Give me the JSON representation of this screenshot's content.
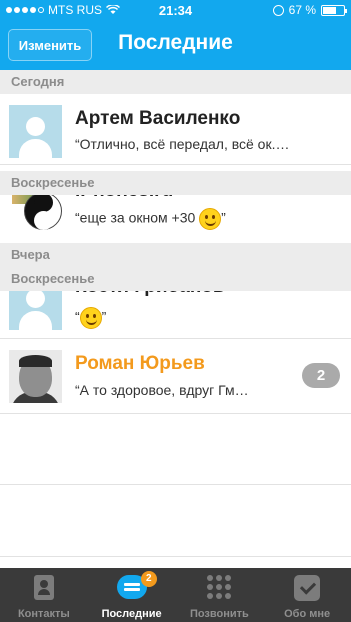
{
  "status_bar": {
    "carrier": "MTS RUS",
    "time": "21:34",
    "battery": "67 %",
    "battery_level": 0.67
  },
  "nav": {
    "edit_label": "Изменить",
    "title": "Последние"
  },
  "sections": {
    "today": "Сегодня",
    "sunday_1": "Воскресенье",
    "yesterday": "Вчера",
    "sunday_2": "Воскресенье"
  },
  "chats": [
    {
      "name": "Артем Василенко",
      "message": "“Отлично, всё передал, всё ок.…"
    },
    {
      "name": "iPhones.ru",
      "message": "“еще за окном +30",
      "message_end": "”"
    },
    {
      "name": "Костя Грибанов",
      "message": "“",
      "message_end": "”"
    },
    {
      "name": "Роман Юрьев",
      "message": "“А то здоровое, вдруг Гм…",
      "unread": "2"
    }
  ],
  "tabs": [
    {
      "label": "Контакты",
      "icon": "contacts-icon"
    },
    {
      "label": "Последние",
      "icon": "recent-chats-icon",
      "badge": "2"
    },
    {
      "label": "Позвонить",
      "icon": "dialpad-icon"
    },
    {
      "label": "Обо мне",
      "icon": "profile-check-icon"
    }
  ],
  "colors": {
    "accent": "#12a8ee",
    "highlight_name": "#f39a1d",
    "tabbar": "#3a3a3a"
  }
}
